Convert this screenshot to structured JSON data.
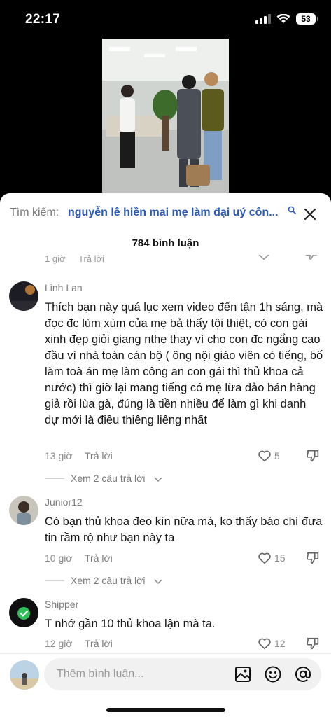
{
  "status_bar": {
    "time": "22:17",
    "battery": "53",
    "icons": [
      "signal-icon",
      "wifi-icon",
      "battery-icon"
    ]
  },
  "video": {
    "description_icon": "video-frame"
  },
  "search": {
    "label": "Tìm kiếm:",
    "query": "nguyễn lê hiền mai mẹ làm đại uý côn...",
    "accent_color": "#2a59b8"
  },
  "comments_header": {
    "count_label": "784 bình luận"
  },
  "partial_comment": {
    "time": "1 giờ",
    "reply_label": "Trả lời"
  },
  "comments": [
    {
      "username": "Linh Lan",
      "text": "Thích bạn này quá lục xem video đến tận 1h sáng, mà đọc đc lùm xùm của mẹ bả thấy tội thiệt, có con gái xinh đẹp giỏi giang nthe thay vì cho con đc ngẩng cao đầu vì nhà toàn cán bộ ( ông nội giáo viên có tiếng, bố làm toà án mẹ làm công an con gái thì thủ khoa cả nước) thì giờ lại mang tiếng có mẹ lừa đảo bán hàng giả rồi lùa gà, đúng là tiền nhiều để làm gì khi danh dự mới là điều thiêng liêng nhất",
      "time": "13 giờ",
      "reply_label": "Trả lời",
      "likes": "5",
      "view_replies": "Xem 2 câu trả lời"
    },
    {
      "username": "Junior12",
      "text": "Có bạn thủ khoa đeo kín nữa mà, ko thấy báo chí đưa tin rầm rộ như bạn này ta",
      "time": "10 giờ",
      "reply_label": "Trả lời",
      "likes": "15",
      "view_replies": "Xem 2 câu trả lời"
    },
    {
      "username": "Shipper",
      "text": "T nhớ gần 10 thủ khoa lận mà ta.",
      "time": "12 giờ",
      "reply_label": "Trả lời",
      "likes": "12"
    }
  ],
  "input_bar": {
    "placeholder": "Thêm bình luận...",
    "icons": [
      "image-icon",
      "emoji-icon",
      "mention-icon"
    ]
  }
}
